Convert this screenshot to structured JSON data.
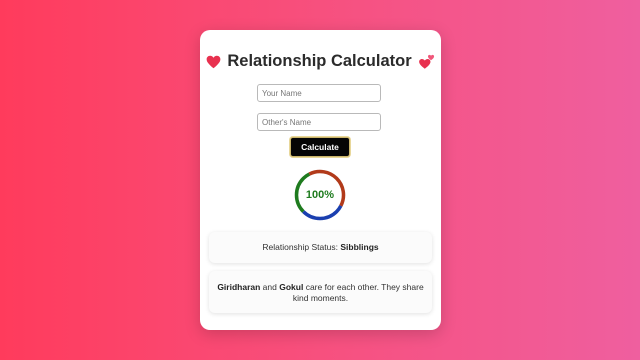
{
  "app": {
    "title": "Relationship Calculator"
  },
  "form": {
    "your_name_placeholder": "Your Name",
    "other_name_placeholder": "Other's Name",
    "calculate_label": "Calculate"
  },
  "result": {
    "percentage": 100,
    "percentage_text": "100%",
    "status_label": "Relationship Status:",
    "status_value": "Sibblings",
    "message": {
      "name_one": "Giridharan",
      "joiner": "and",
      "name_two": "Gokul",
      "text": "care for each other. They share kind moments."
    }
  },
  "colors": {
    "accent_text": "#1e7b1e",
    "ring_segments": [
      "#1e7b1e",
      "#b23a1a",
      "#1a3fb0"
    ],
    "heart": "#e8314f"
  },
  "icons": {
    "title_left": "heart-icon",
    "title_right": "two-hearts-icon"
  }
}
